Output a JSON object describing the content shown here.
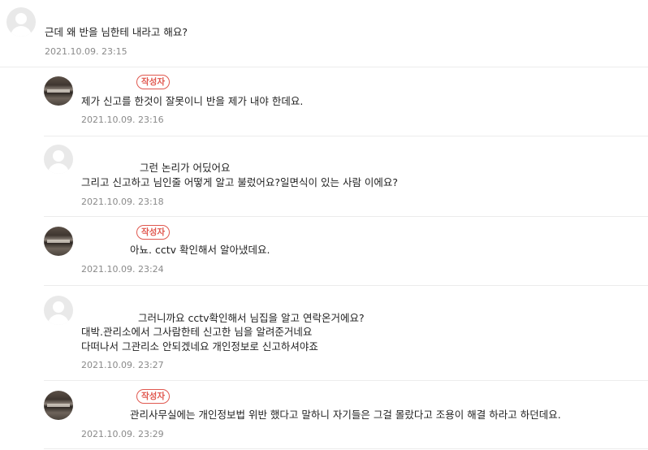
{
  "author_badge": "작성자",
  "comments": [
    {
      "text_lines": [
        "근데 왜 반을 님한테 내라고 해요?"
      ],
      "date": "2021.10.09. 23:15",
      "avatar": "default-avatar-icon"
    },
    {
      "text_lines": [
        "제가 신고를 한것이 잘못이니 반을 제가 내야 한데요."
      ],
      "date": "2021.10.09. 23:16",
      "avatar": "photo-avatar"
    },
    {
      "text_lines": [
        "그런 논리가 어딨어요",
        "그리고 신고하고 님인줄 어떻게 알고 불렀어요?일면식이 있는 사람 이에요?"
      ],
      "date": "2021.10.09. 23:18",
      "avatar": "default-avatar-icon"
    },
    {
      "text_lines": [
        "아뇨. cctv 확인해서 알아냈데요."
      ],
      "date": "2021.10.09. 23:24",
      "avatar": "photo-avatar"
    },
    {
      "text_lines": [
        "그러니까요 cctv확인해서 님집을 알고 연락온거에요?",
        "대박.관리소에서 그사람한테 신고한 님을 알려준거네요",
        "다떠나서 그관리소 안되겠네요 개인정보로 신고하셔야죠"
      ],
      "date": "2021.10.09. 23:27",
      "avatar": "default-avatar-icon"
    },
    {
      "text_lines": [
        "관리사무실에는 개인정보법 위반 했다고 말하니 자기들은 그걸 몰랐다고 조용이 해결 하라고 하던데요."
      ],
      "date": "2021.10.09. 23:29",
      "avatar": "photo-avatar"
    }
  ]
}
